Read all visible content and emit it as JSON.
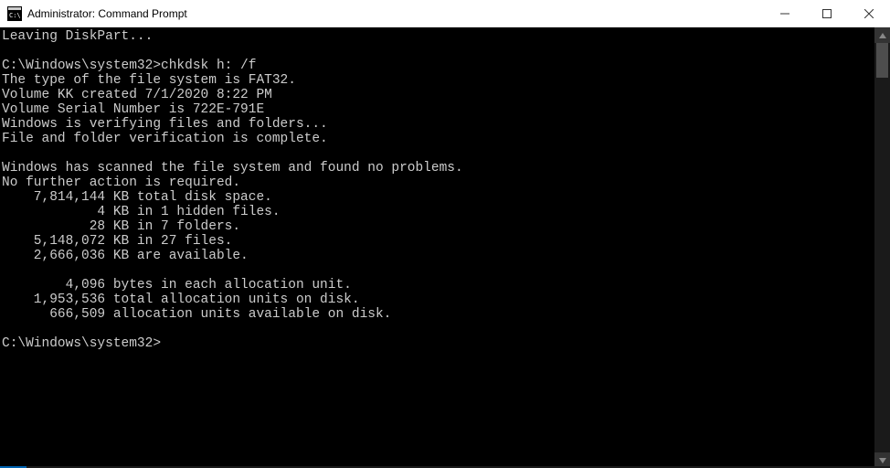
{
  "window": {
    "title": "Administrator: Command Prompt"
  },
  "terminal": {
    "prompt_path": "C:\\Windows\\system32>",
    "last_command": "chkdsk h: /f",
    "lines": [
      "Leaving DiskPart...",
      "",
      "C:\\Windows\\system32>chkdsk h: /f",
      "The type of the file system is FAT32.",
      "Volume KK created 7/1/2020 8:22 PM",
      "Volume Serial Number is 722E-791E",
      "Windows is verifying files and folders...",
      "File and folder verification is complete.",
      "",
      "Windows has scanned the file system and found no problems.",
      "No further action is required.",
      "    7,814,144 KB total disk space.",
      "            4 KB in 1 hidden files.",
      "           28 KB in 7 folders.",
      "    5,148,072 KB in 27 files.",
      "    2,666,036 KB are available.",
      "",
      "        4,096 bytes in each allocation unit.",
      "    1,953,536 total allocation units on disk.",
      "      666,509 allocation units available on disk.",
      "",
      "C:\\Windows\\system32>"
    ]
  }
}
